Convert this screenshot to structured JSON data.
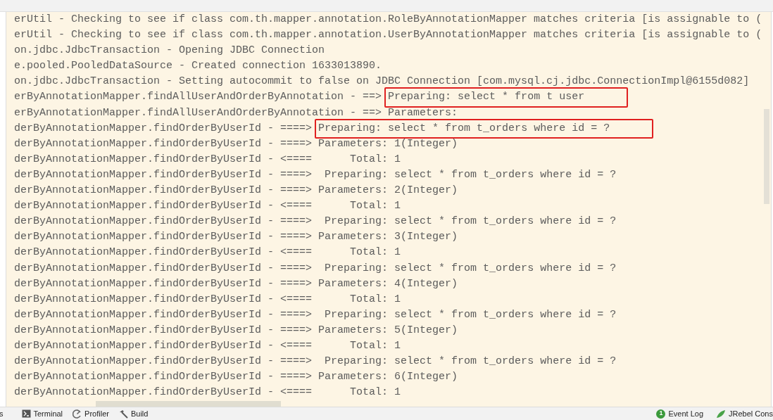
{
  "log_lines": [
    {
      "prefix": "erUtil - Checking to see if class com.th.mapper.annotation.RoleByAnnotationMapper matches criteria [is assignable to ("
    },
    {
      "prefix": "erUtil - Checking to see if class com.th.mapper.annotation.UserByAnnotationMapper matches criteria [is assignable to ("
    },
    {
      "prefix": "on.jdbc.JdbcTransaction - Opening JDBC Connection"
    },
    {
      "prefix": "e.pooled.PooledDataSource - Created connection 1633013890."
    },
    {
      "prefix": "on.jdbc.JdbcTransaction - Setting autocommit to false on JDBC Connection [com.mysql.cj.jdbc.ConnectionImpl@6155d082]"
    },
    {
      "prefix": "erByAnnotationMapper.findAllUserAndOrderByAnnotation - ==> ",
      "message": "Preparing: select * from t user",
      "highlighted": true
    },
    {
      "prefix": "erByAnnotationMapper.findAllUserAndOrderByAnnotation - ==> ",
      "message": "Parameters:",
      "highlighted": false
    },
    {
      "prefix": "derByAnnotationMapper.findOrderByUserId - ====> ",
      "message": "Preparing: select * from t_orders where id = ?",
      "highlighted": true
    },
    {
      "prefix": "derByAnnotationMapper.findOrderByUserId - ====> ",
      "message": "Parameters: 1(Integer)",
      "highlighted": false
    },
    {
      "prefix": "derByAnnotationMapper.findOrderByUserId - <====      ",
      "message": "Total: 1",
      "highlighted": false
    },
    {
      "prefix": "derByAnnotationMapper.findOrderByUserId - ====>  ",
      "message": "Preparing: select * from t_orders where id = ?",
      "highlighted": false
    },
    {
      "prefix": "derByAnnotationMapper.findOrderByUserId - ====> ",
      "message": "Parameters: 2(Integer)",
      "highlighted": false
    },
    {
      "prefix": "derByAnnotationMapper.findOrderByUserId - <====      ",
      "message": "Total: 1",
      "highlighted": false
    },
    {
      "prefix": "derByAnnotationMapper.findOrderByUserId - ====>  ",
      "message": "Preparing: select * from t_orders where id = ?",
      "highlighted": false
    },
    {
      "prefix": "derByAnnotationMapper.findOrderByUserId - ====> ",
      "message": "Parameters: 3(Integer)",
      "highlighted": false
    },
    {
      "prefix": "derByAnnotationMapper.findOrderByUserId - <====      ",
      "message": "Total: 1",
      "highlighted": false
    },
    {
      "prefix": "derByAnnotationMapper.findOrderByUserId - ====>  ",
      "message": "Preparing: select * from t_orders where id = ?",
      "highlighted": false
    },
    {
      "prefix": "derByAnnotationMapper.findOrderByUserId - ====> ",
      "message": "Parameters: 4(Integer)",
      "highlighted": false
    },
    {
      "prefix": "derByAnnotationMapper.findOrderByUserId - <====      ",
      "message": "Total: 1",
      "highlighted": false
    },
    {
      "prefix": "derByAnnotationMapper.findOrderByUserId - ====>  ",
      "message": "Preparing: select * from t_orders where id = ?",
      "highlighted": false
    },
    {
      "prefix": "derByAnnotationMapper.findOrderByUserId - ====> ",
      "message": "Parameters: 5(Integer)",
      "highlighted": false
    },
    {
      "prefix": "derByAnnotationMapper.findOrderByUserId - <====      ",
      "message": "Total: 1",
      "highlighted": false
    },
    {
      "prefix": "derByAnnotationMapper.findOrderByUserId - ====>  ",
      "message": "Preparing: select * from t_orders where id = ?",
      "highlighted": false
    },
    {
      "prefix": "derByAnnotationMapper.findOrderByUserId - ====> ",
      "message": "Parameters: 6(Integer)",
      "highlighted": false
    },
    {
      "prefix": "derByAnnotationMapper.findOrderByUserId - <====      ",
      "message": "Total: 1",
      "highlighted": false
    }
  ],
  "tool_tabs": [
    {
      "kind": "cut",
      "label": "s"
    },
    {
      "kind": "terminal",
      "label": "Terminal"
    },
    {
      "kind": "profiler",
      "label": "Profiler"
    },
    {
      "kind": "build",
      "label": "Build"
    }
  ],
  "right_tabs": [
    {
      "kind": "event_log",
      "badge": "1",
      "label": "Event Log"
    },
    {
      "kind": "jrebel",
      "label": "JRebel Cons"
    }
  ]
}
